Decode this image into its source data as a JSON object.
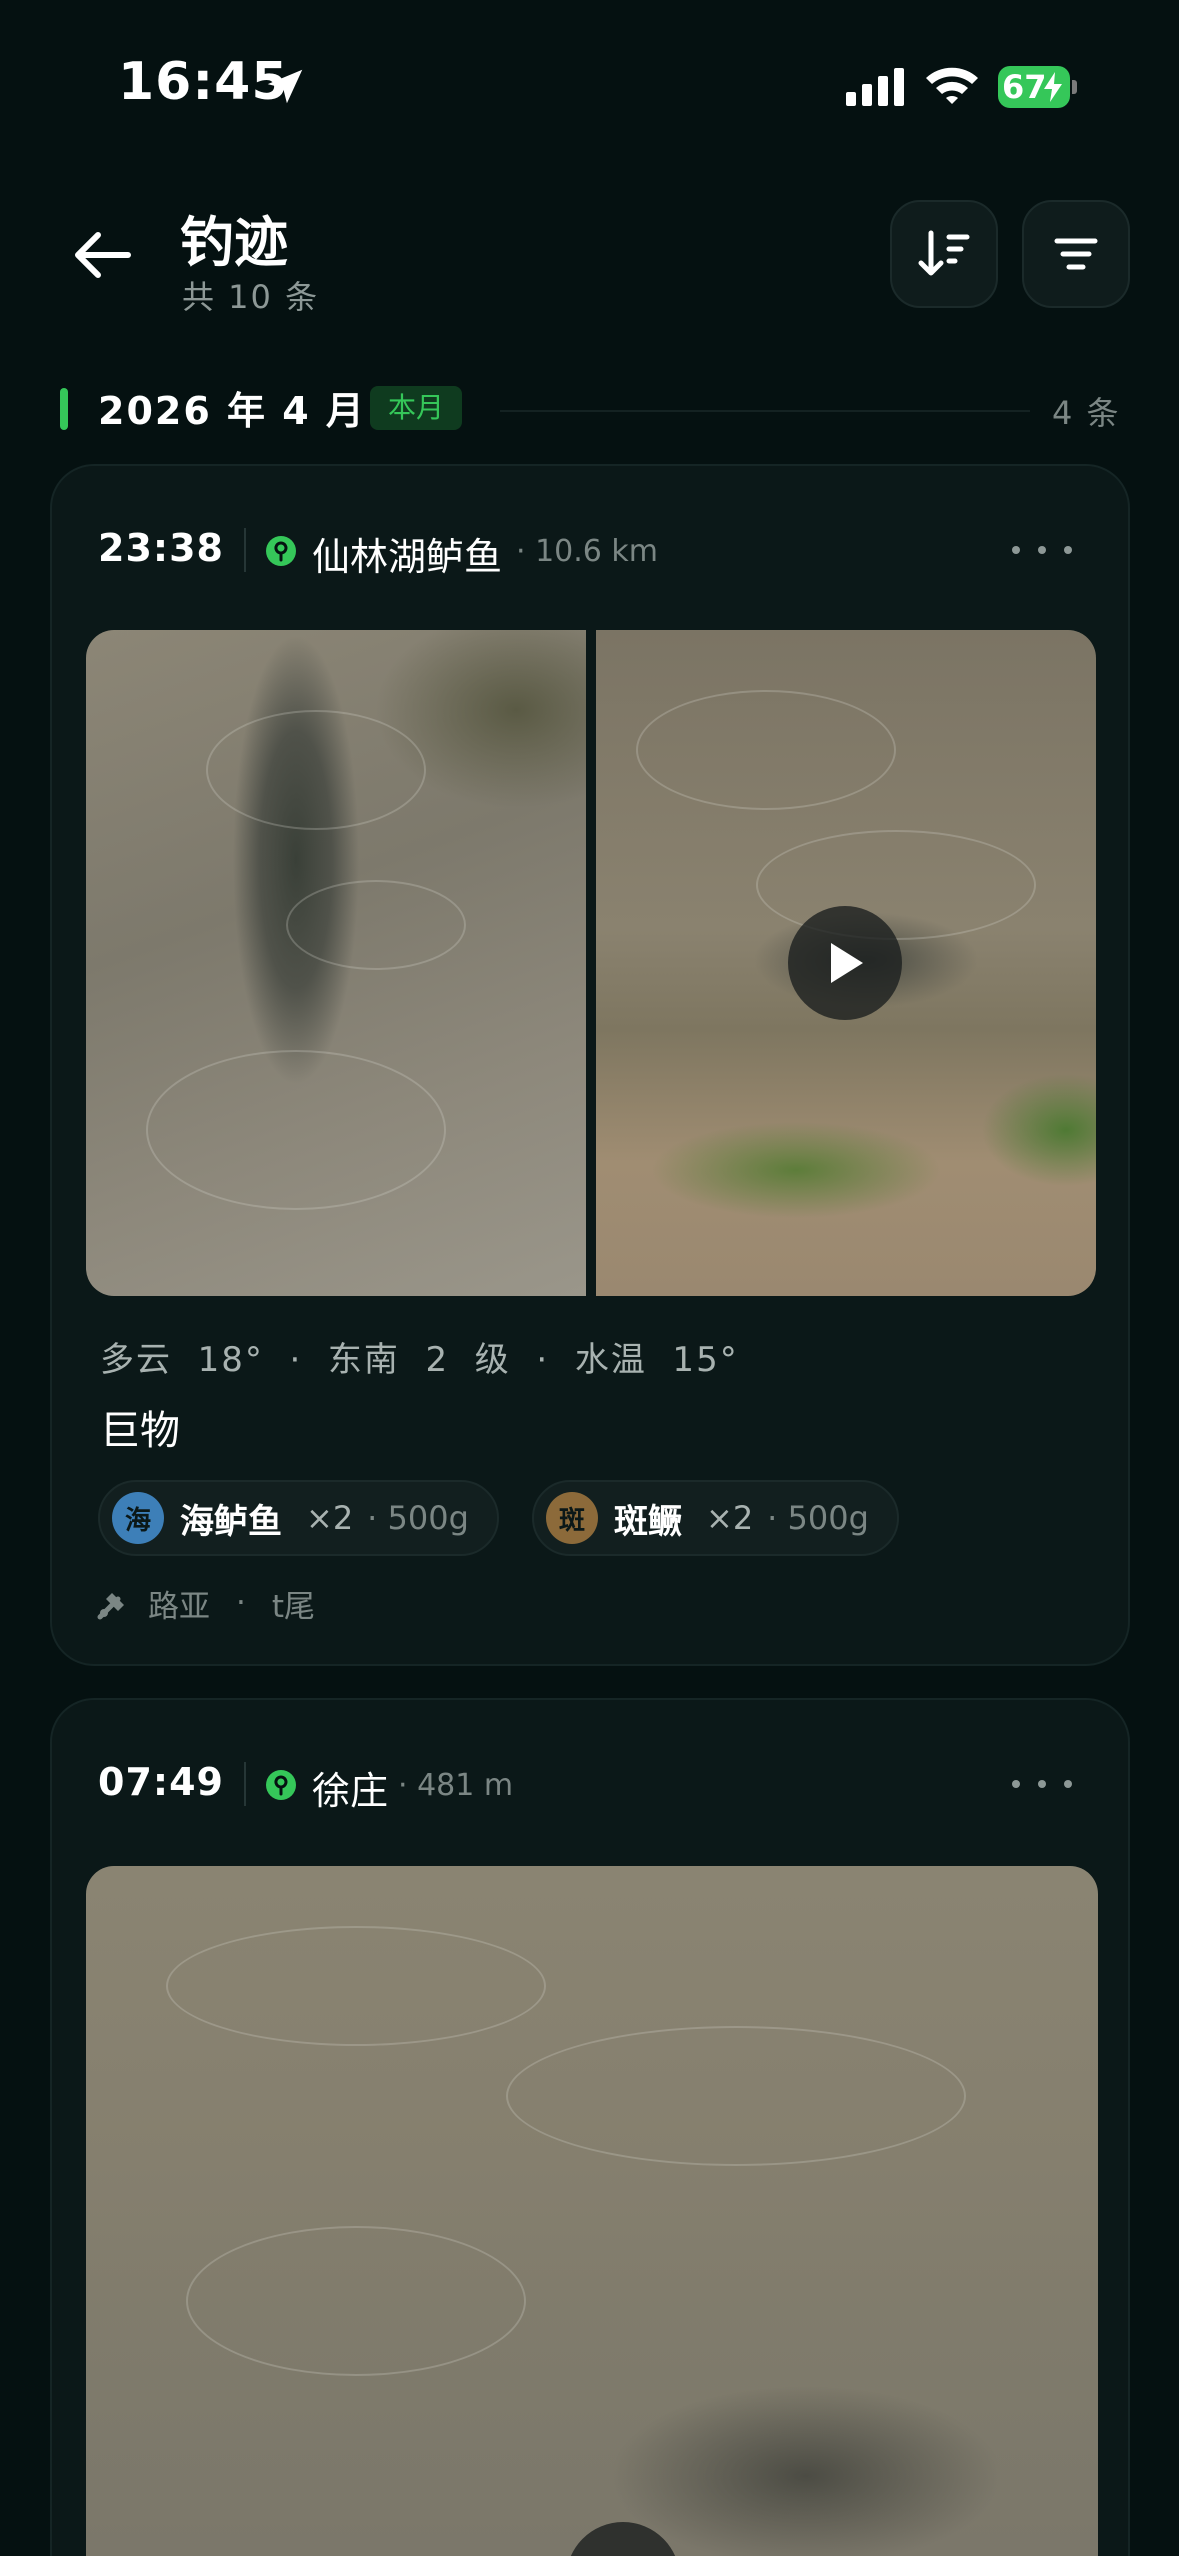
{
  "status_bar": {
    "time": "16:45",
    "battery": "67"
  },
  "header": {
    "title": "钓迹",
    "subtitle": "共 10 条"
  },
  "month": {
    "title": "2026 年 4 月",
    "badge": "本月",
    "count": "4 条"
  },
  "records": [
    {
      "time": "23:38",
      "spot": "仙林湖鲈鱼",
      "distance": "· 10.6 km",
      "weather": "多云  18°  ·  东南  2  级  ·  水温  15°",
      "note": "巨物",
      "catches": [
        {
          "avatar": "海",
          "name": "海鲈鱼",
          "count": "×2",
          "weight": "· 500g",
          "color": "#3d7fb8"
        },
        {
          "avatar": "斑",
          "name": "斑鳜",
          "count": "×2",
          "weight": "· 500g",
          "color": "#8c6a3a"
        }
      ],
      "method": "路亚",
      "method_sep": "·",
      "lure": "t尾"
    },
    {
      "time": "07:49",
      "spot": "徐庄",
      "distance": "· 481 m"
    }
  ],
  "colors": {
    "accent": "#35c759",
    "background": "#051111",
    "card": "#0b1818"
  },
  "icons": [
    "back-arrow-icon",
    "sort-icon",
    "filter-icon",
    "location-pin-icon",
    "more-icon",
    "play-icon",
    "fishing-rod-icon"
  ]
}
